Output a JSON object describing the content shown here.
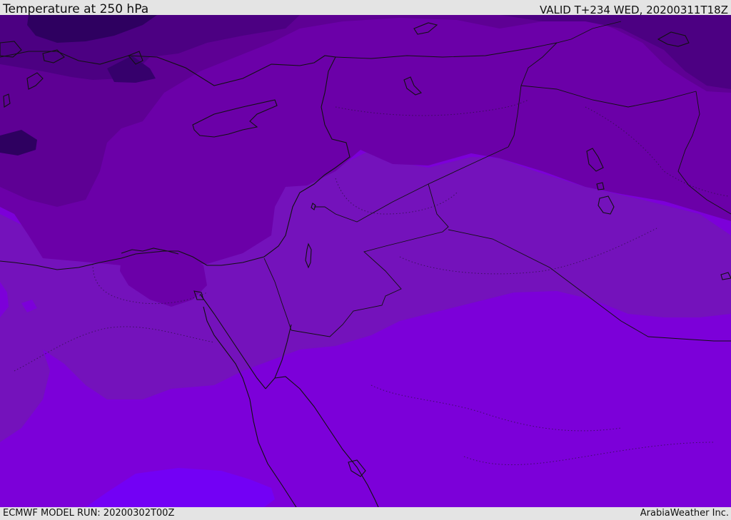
{
  "header": {
    "title": "Temperature at 250 hPa",
    "valid_time": "VALID T+234 WED, 20200311T18Z"
  },
  "footer": {
    "model_run": "ECMWF MODEL RUN: 20200302T00Z",
    "credit": "ArabiaWeather Inc."
  },
  "map": {
    "field": "temperature",
    "level": "250 hPa",
    "bands": [
      {
        "id": "band-coldest",
        "color": "#2e0060"
      },
      {
        "id": "band-very-cold",
        "color": "#4b0082"
      },
      {
        "id": "band-cold",
        "color": "#5e0094"
      },
      {
        "id": "band-cool",
        "color": "#6e00a6"
      },
      {
        "id": "band-mid",
        "color": "#7a10b8"
      },
      {
        "id": "band-warm",
        "color": "#7c00d9"
      },
      {
        "id": "band-warmest",
        "color": "#7300f5"
      }
    ],
    "colors": {
      "coastline": "#111111",
      "border": "#111111"
    }
  }
}
